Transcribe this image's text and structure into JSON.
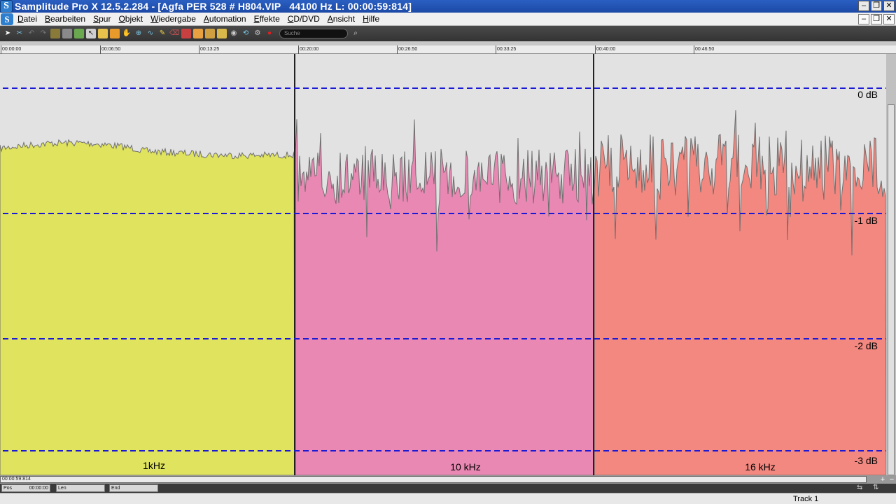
{
  "window": {
    "logo_letter": "S",
    "title": "Samplitude Pro X 12.5.2.284 - [Agfa PER 528 # H804.VIP   44100 Hz L: 00:00:59:814]",
    "buttons": [
      "–",
      "❐",
      "✕"
    ]
  },
  "menu": {
    "items": [
      "Datei",
      "Bearbeiten",
      "Spur",
      "Objekt",
      "Wiedergabe",
      "Automation",
      "Effekte",
      "CD/DVD",
      "Ansicht",
      "Hilfe"
    ]
  },
  "toolbar": {
    "search_placeholder": "Suche"
  },
  "ruler": {
    "labels": [
      "00:00:00",
      "00:06:50",
      "00:13:25",
      "00:20:00",
      "00:26:50",
      "00:33:25",
      "00:40:00",
      "00:46:50"
    ]
  },
  "waveform": {
    "db_labels": [
      "0 dB",
      "-1 dB",
      "-2 dB",
      "-3 dB"
    ],
    "regions": [
      {
        "label": "1kHz",
        "color": "#dfe35e"
      },
      {
        "label": "10 kHz",
        "color": "#e988b3"
      },
      {
        "label": "16 kHz",
        "color": "#f28880"
      }
    ],
    "gridline_color": "#1a1ad6"
  },
  "scroll": {
    "position_label": "00:00:59:814"
  },
  "status": {
    "pos_label": "Pos",
    "pos_value": "00:00:00",
    "len_label": "Len",
    "end_label": "End"
  },
  "bottom": {
    "track_name": "Track 1"
  }
}
